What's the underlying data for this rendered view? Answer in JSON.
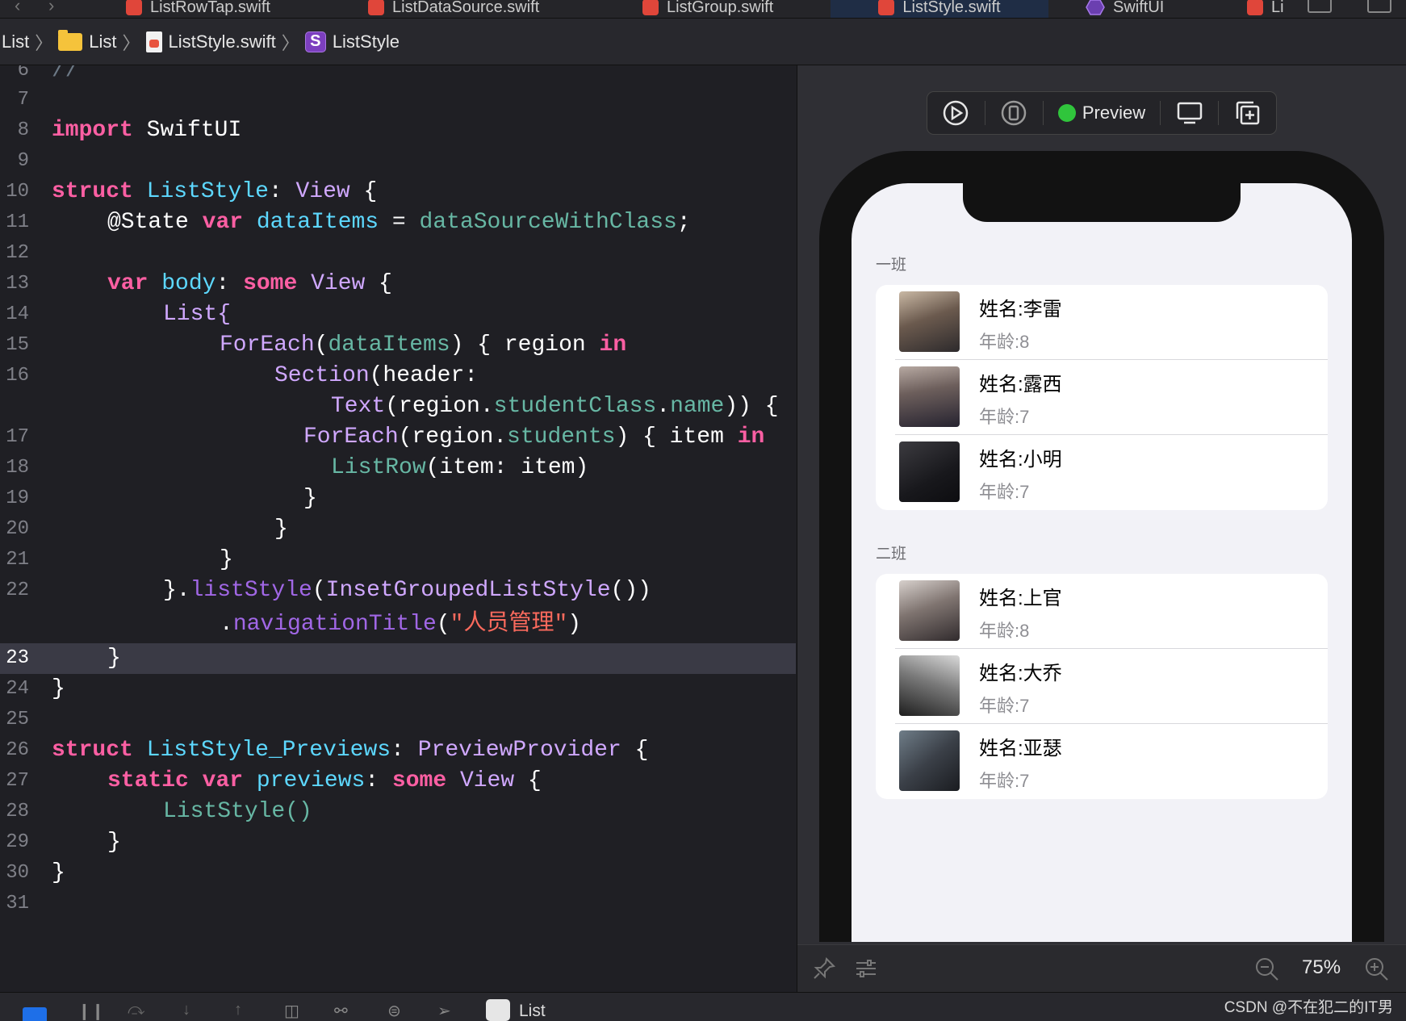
{
  "tabs": [
    {
      "label": "ListRowTap.swift",
      "icon": "swift-file-icon"
    },
    {
      "label": "ListDataSource.swift",
      "icon": "swift-file-icon"
    },
    {
      "label": "ListGroup.swift",
      "icon": "swift-file-icon"
    },
    {
      "label": "ListStyle.swift",
      "icon": "swift-file-icon",
      "active": true
    },
    {
      "label": "SwiftUI",
      "icon": "swiftui-hex-icon"
    },
    {
      "label": "Li",
      "icon": "swift-file-icon"
    }
  ],
  "breadcrumb": [
    "List",
    "List",
    "ListStyle.swift",
    "ListStyle"
  ],
  "editor": {
    "current_line": "23",
    "lines": [
      {
        "n": "6"
      },
      {
        "n": "7"
      },
      {
        "n": "8"
      },
      {
        "n": "9"
      },
      {
        "n": "10"
      },
      {
        "n": "11"
      },
      {
        "n": "12"
      },
      {
        "n": "13"
      },
      {
        "n": "14"
      },
      {
        "n": "15"
      },
      {
        "n": "16"
      },
      {
        "n": ""
      },
      {
        "n": "17"
      },
      {
        "n": "18"
      },
      {
        "n": "19"
      },
      {
        "n": "20"
      },
      {
        "n": "21"
      },
      {
        "n": "22"
      },
      {
        "n": ""
      },
      {
        "n": "23"
      },
      {
        "n": "24"
      },
      {
        "n": "25"
      },
      {
        "n": "26"
      },
      {
        "n": "27"
      },
      {
        "n": "28"
      },
      {
        "n": "29"
      },
      {
        "n": "30"
      },
      {
        "n": "31"
      }
    ],
    "tokens": {
      "l6": "//",
      "l8_kw": "import",
      "l8_t": "SwiftUI",
      "l10_kw": "struct",
      "l10_name": "ListStyle",
      "l10_colon": ":",
      "l10_view": "View",
      "l10_brace": "{",
      "l11_attr": "@State",
      "l11_kw": "var",
      "l11_name": "dataItems",
      "l11_eq": "=",
      "l11_val": "dataSourceWithClass",
      "l11_semi": ";",
      "l13_kw": "var",
      "l13_name": "body",
      "l13_colon": ":",
      "l13_some": "some",
      "l13_view": "View",
      "l13_brace": "{",
      "l14": "List{",
      "l15_fe": "ForEach",
      "l15_open": "(",
      "l15_arg": "dataItems",
      "l15_rest": ") { region",
      "l15_in": "in",
      "l16_sec": "Section",
      "l16_rest": "(header:",
      "l16b_text": "Text",
      "l16b_open": "(region.",
      "l16b_sc": "studentClass",
      "l16b_dot": ".",
      "l16b_name": "name",
      "l16b_rest": ")) {",
      "l17_fe": "ForEach",
      "l17_open": "(region.",
      "l17_st": "students",
      "l17_rest": ") { item",
      "l17_in": "in",
      "l18_lr": "ListRow",
      "l18_rest": "(item: item)",
      "l19": "}",
      "l20": "}",
      "l21": "}",
      "l22_close": "}.",
      "l22_ls": "listStyle",
      "l22_open": "(",
      "l22_igs": "InsetGroupedListStyle",
      "l22_rest": "())",
      "l22b_dot": ".",
      "l22b_nt": "navigationTitle",
      "l22b_open": "(",
      "l22b_str": "\"人员管理\"",
      "l22b_close": ")",
      "l23": "}",
      "l24": "}",
      "l26_kw": "struct",
      "l26_name": "ListStyle_Previews",
      "l26_colon": ":",
      "l26_pp": "PreviewProvider",
      "l26_brace": "{",
      "l27_static": "static",
      "l27_var": "var",
      "l27_name": "previews",
      "l27_colon": ":",
      "l27_some": "some",
      "l27_view": "View",
      "l27_brace": "{",
      "l28": "ListStyle()",
      "l29": "}",
      "l30": "}"
    }
  },
  "preview": {
    "label": "Preview",
    "zoom": "75%",
    "sections": [
      {
        "header": "一班",
        "rows": [
          {
            "name": "姓名:李雷",
            "age": "年龄:8"
          },
          {
            "name": "姓名:露西",
            "age": "年龄:7"
          },
          {
            "name": "姓名:小明",
            "age": "年龄:7"
          }
        ]
      },
      {
        "header": "二班",
        "rows": [
          {
            "name": "姓名:上官",
            "age": "年龄:8"
          },
          {
            "name": "姓名:大乔",
            "age": "年龄:7"
          },
          {
            "name": "姓名:亚瑟",
            "age": "年龄:7"
          }
        ]
      }
    ]
  },
  "debugbar": {
    "scheme": "List"
  },
  "watermark": "CSDN @不在犯二的IT男",
  "colors": {
    "keyword": "#fc5fa3",
    "type": "#d0a8ff",
    "declaration": "#5dd8ff",
    "function": "#67b7a4",
    "property": "#a167e6",
    "string": "#fc6a5d"
  }
}
